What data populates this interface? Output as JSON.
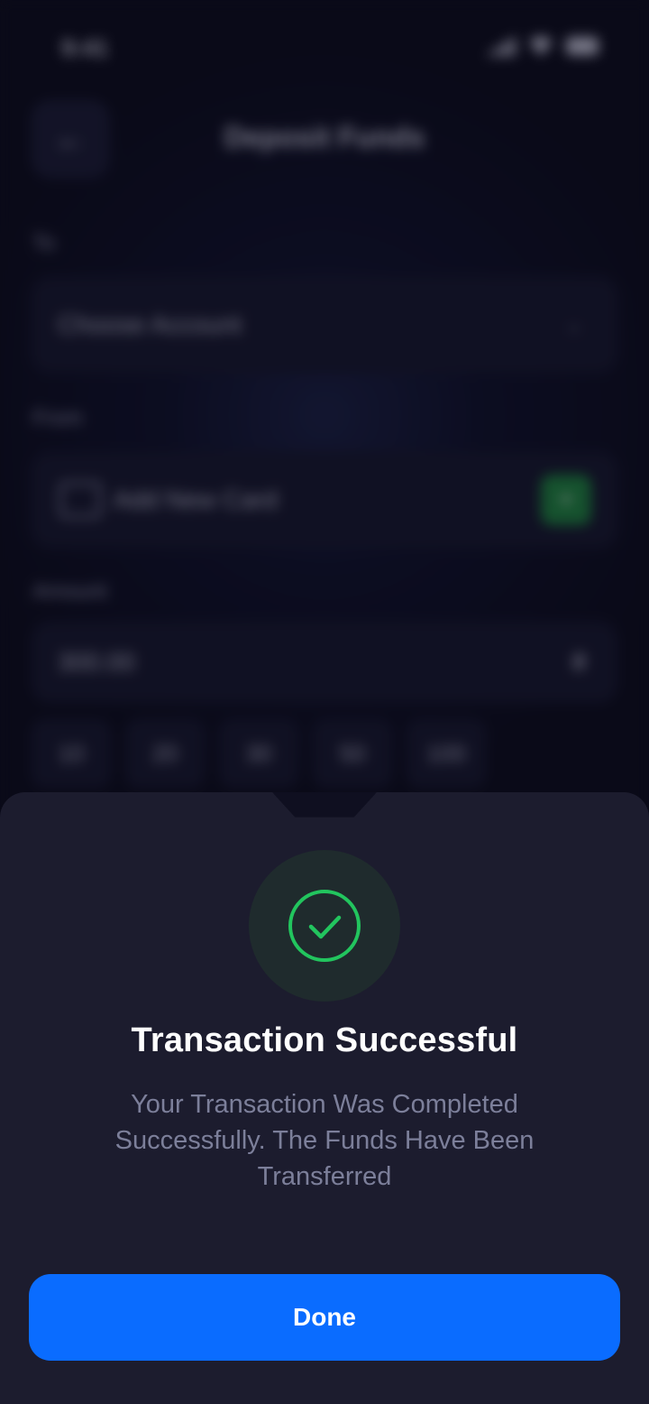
{
  "status_bar": {
    "time": "9:41"
  },
  "background_screen": {
    "back_icon": "arrow-left-icon",
    "title": "Deposit Funds",
    "to_label": "To",
    "to_placeholder": "Choose Account",
    "from_label": "From",
    "from_value": "Add New Card",
    "amount_label": "Amount",
    "amount_value": "300.00",
    "currency_symbol": "₴",
    "quick_amounts": [
      "10",
      "20",
      "30",
      "50",
      "100"
    ]
  },
  "sheet": {
    "icon": "check-circle-icon",
    "title": "Transaction Successful",
    "message": "Your Transaction Was Completed Successfully. The Funds Have Been Transferred",
    "done_label": "Done"
  },
  "colors": {
    "accent": "#0a6cff",
    "success": "#22c55e",
    "sheet_bg": "#1c1c2e"
  }
}
